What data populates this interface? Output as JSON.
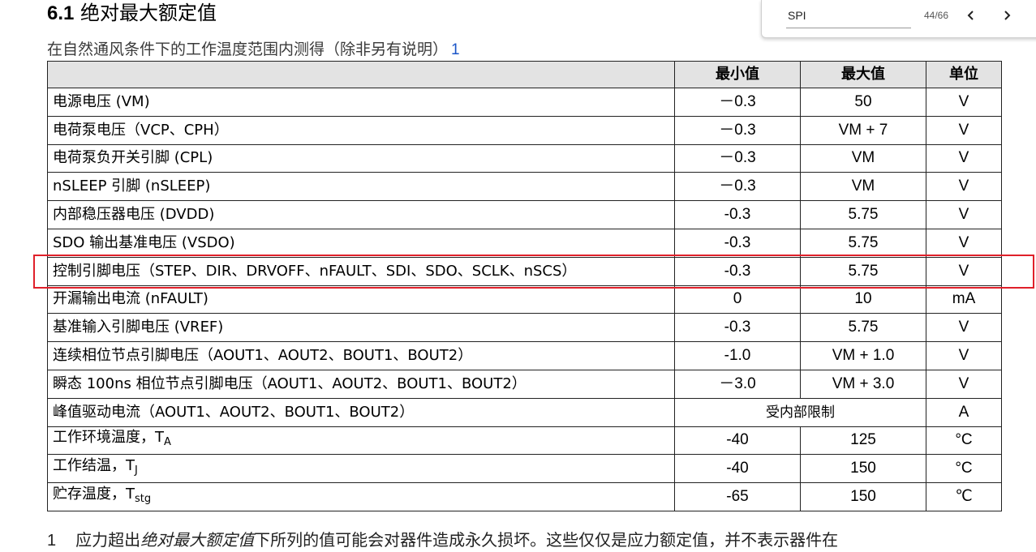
{
  "heading": {
    "number": "6.1",
    "title": "绝对最大额定值"
  },
  "caption": {
    "text": "在自然通风条件下的工作温度范围内测得（除非另有说明）",
    "footnote_ref": "1"
  },
  "table": {
    "headers": {
      "param": "",
      "min": "最小值",
      "max": "最大值",
      "unit": "单位"
    },
    "rows": [
      {
        "param": "电源电压 (VM)",
        "min": "－0.3",
        "max": "50",
        "unit": "V"
      },
      {
        "param": "电荷泵电压（VCP、CPH）",
        "min": "－0.3",
        "max": "VM + 7",
        "unit": "V"
      },
      {
        "param": "电荷泵负开关引脚 (CPL)",
        "min": "－0.3",
        "max": "VM",
        "unit": "V"
      },
      {
        "param": "nSLEEP 引脚 (nSLEEP)",
        "min": "－0.3",
        "max": "VM",
        "unit": "V"
      },
      {
        "param": "内部稳压器电压 (DVDD)",
        "min": "-0.3",
        "max": "5.75",
        "unit": "V"
      },
      {
        "param": "SDO 输出基准电压 (VSDO)",
        "min": "-0.3",
        "max": "5.75",
        "unit": "V"
      },
      {
        "param": "控制引脚电压（STEP、DIR、DRVOFF、nFAULT、SDI、SDO、SCLK、nSCS）",
        "min": "-0.3",
        "max": "5.75",
        "unit": "V"
      },
      {
        "param": "开漏输出电流 (nFAULT)",
        "min": "0",
        "max": "10",
        "unit": "mA"
      },
      {
        "param": "基准输入引脚电压 (VREF)",
        "min": "-0.3",
        "max": "5.75",
        "unit": "V"
      },
      {
        "param": "连续相位节点引脚电压（AOUT1、AOUT2、BOUT1、BOUT2）",
        "min": "-1.0",
        "max": "VM + 1.0",
        "unit": "V"
      },
      {
        "param": "瞬态 100ns 相位节点引脚电压（AOUT1、AOUT2、BOUT1、BOUT2）",
        "min": "－3.0",
        "max": "VM + 3.0",
        "unit": "V"
      },
      {
        "param": "峰值驱动电流（AOUT1、AOUT2、BOUT1、BOUT2）",
        "merged": "受内部限制",
        "unit": "A"
      },
      {
        "param": "工作环境温度，T",
        "sub": "A",
        "min": "-40",
        "max": "125",
        "unit": "°C"
      },
      {
        "param": "工作结温，T",
        "sub": "J",
        "min": "-40",
        "max": "150",
        "unit": "°C"
      },
      {
        "param": "贮存温度，T",
        "sub": "stg",
        "min": "-65",
        "max": "150",
        "unit": "℃"
      }
    ]
  },
  "footnote": {
    "number": "1",
    "text_before": "应力超出",
    "emphasis": "绝对最大额定值",
    "text_after": "下所列的值可能会对器件造成永久损坏。这些仅仅是应力额定值，并不表示器件在"
  },
  "search": {
    "query": "SPI",
    "match_count": "44/66"
  },
  "colors": {
    "highlight": "#e0202a",
    "header_bg": "#e3e3e3",
    "footnote_link": "#1a55c8"
  },
  "icons": {
    "prev": "chevron-left-icon",
    "next": "chevron-right-icon"
  }
}
